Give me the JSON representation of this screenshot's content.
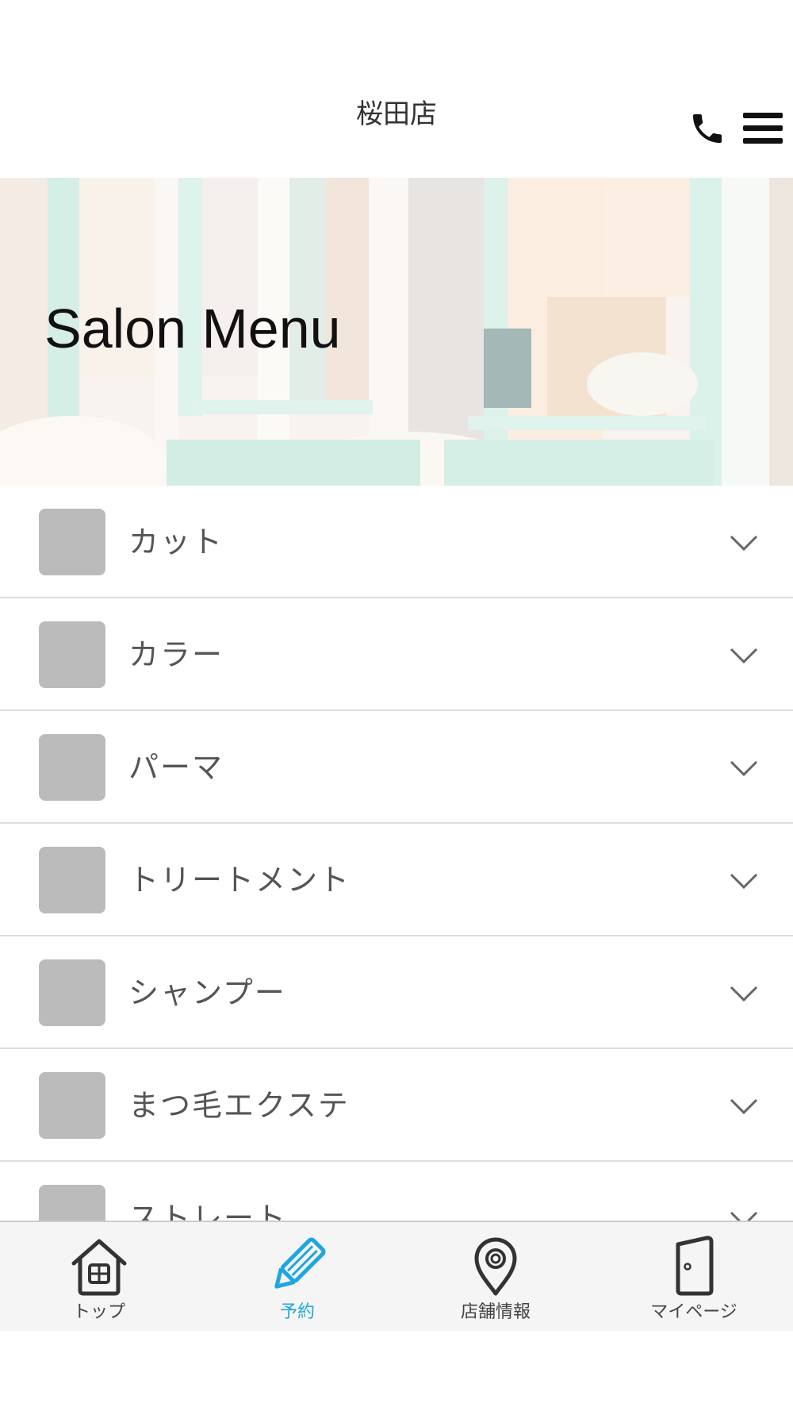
{
  "header": {
    "title": "桜田店",
    "phone_icon": "phone-icon",
    "menu_icon": "hamburger-menu-icon"
  },
  "hero": {
    "title": "Salon Menu"
  },
  "menu_items": [
    {
      "label": "カット"
    },
    {
      "label": "カラー"
    },
    {
      "label": "パーマ"
    },
    {
      "label": "トリートメント"
    },
    {
      "label": "シャンプー"
    },
    {
      "label": "まつ毛エクステ"
    },
    {
      "label": "ストレート"
    }
  ],
  "tabbar": {
    "active_color": "#1fa6e0",
    "tabs": [
      {
        "label": "トップ",
        "icon": "home-icon",
        "active": false
      },
      {
        "label": "予約",
        "icon": "pencil-icon",
        "active": true
      },
      {
        "label": "店舗情報",
        "icon": "location-pin-icon",
        "active": false
      },
      {
        "label": "マイページ",
        "icon": "door-icon",
        "active": false
      }
    ]
  }
}
